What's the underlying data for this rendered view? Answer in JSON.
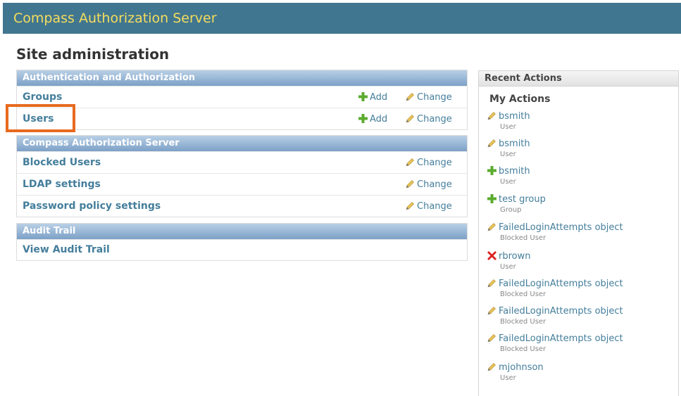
{
  "header": {
    "title": "Compass Authorization Server"
  },
  "page": {
    "title": "Site administration"
  },
  "modules": [
    {
      "caption": "Authentication and Authorization",
      "rows": [
        {
          "name": "Groups",
          "add": "Add",
          "change": "Change"
        },
        {
          "name": "Users",
          "add": "Add",
          "change": "Change"
        }
      ]
    },
    {
      "caption": "Compass Authorization Server",
      "rows": [
        {
          "name": "Blocked Users",
          "change": "Change"
        },
        {
          "name": "LDAP settings",
          "change": "Change"
        },
        {
          "name": "Password policy settings",
          "change": "Change"
        }
      ]
    },
    {
      "caption": "Audit Trail",
      "rows": [
        {
          "name": "View Audit Trail"
        }
      ]
    }
  ],
  "recent": {
    "caption": "Recent Actions",
    "my_actions": "My Actions",
    "items": [
      {
        "icon": "pencil-icon",
        "label": "bsmith",
        "type": "User"
      },
      {
        "icon": "pencil-icon",
        "label": "bsmith",
        "type": "User"
      },
      {
        "icon": "plus-icon",
        "label": "bsmith",
        "type": "User"
      },
      {
        "icon": "plus-icon",
        "label": "test group",
        "type": "Group"
      },
      {
        "icon": "pencil-icon",
        "label": "FailedLoginAttempts object",
        "type": "Blocked User"
      },
      {
        "icon": "delete-icon",
        "label": "rbrown",
        "type": "User"
      },
      {
        "icon": "pencil-icon",
        "label": "FailedLoginAttempts object",
        "type": "Blocked User"
      },
      {
        "icon": "pencil-icon",
        "label": "FailedLoginAttempts object",
        "type": "Blocked User"
      },
      {
        "icon": "pencil-icon",
        "label": "FailedLoginAttempts object",
        "type": "Blocked User"
      },
      {
        "icon": "pencil-icon",
        "label": "mjohnson",
        "type": "User"
      }
    ]
  },
  "colors": {
    "header_bg": "#417690",
    "header_text": "#f5dd5d",
    "link": "#447e9b",
    "highlight": "#e86a1f"
  }
}
